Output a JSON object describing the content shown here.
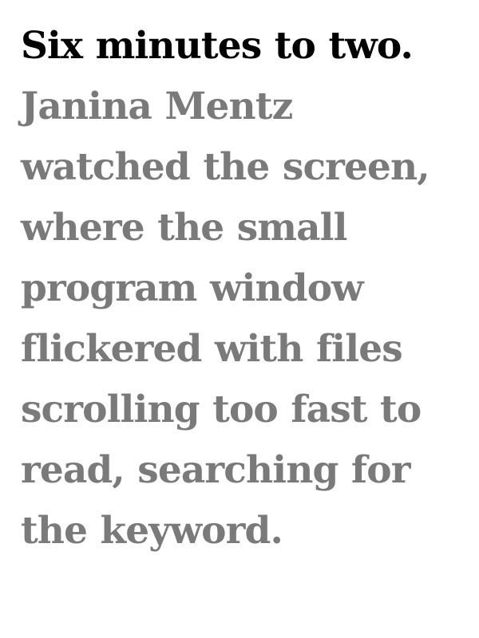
{
  "excerpt": {
    "lead": "Six minutes to two.",
    "body": "Janina Mentz watched the screen, where the small program window flickered with files scrolling too fast to read, searching for the keyword."
  },
  "colors": {
    "lead": "#000000",
    "body": "#7a7a7a",
    "background": "#ffffff"
  }
}
